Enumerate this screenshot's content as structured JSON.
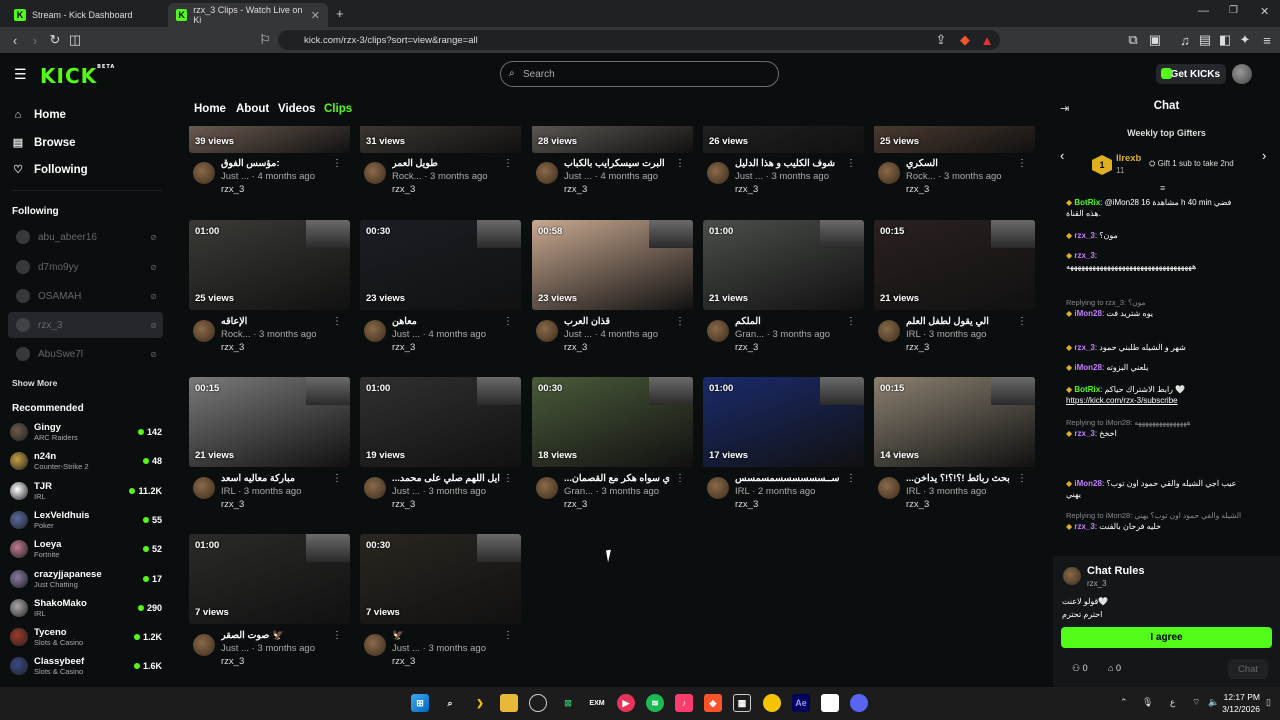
{
  "browser": {
    "tabs": [
      {
        "title": "Stream - Kick Dashboard"
      },
      {
        "title": "rzx_3 Clips - Watch Live on Ki"
      }
    ],
    "url": "kick.com/rzx-3/clips?sort=view&range=all"
  },
  "header": {
    "logo": "KICK",
    "logo_badge": "BETA",
    "search_placeholder": "Search",
    "get_kicks": "Get KICKs"
  },
  "sidebar": {
    "nav": [
      {
        "label": "Home",
        "icon": "home-icon"
      },
      {
        "label": "Browse",
        "icon": "browse-icon"
      },
      {
        "label": "Following",
        "icon": "heart-icon"
      }
    ],
    "following_title": "Following",
    "following": [
      {
        "name": "abu_abeer16"
      },
      {
        "name": "d7mo9yy"
      },
      {
        "name": "OSAMAH"
      },
      {
        "name": "rzx_3"
      },
      {
        "name": "AbuSwe7l"
      }
    ],
    "show_more": "Show More",
    "recommended_title": "Recommended",
    "recommended": [
      {
        "name": "Gingy",
        "category": "ARC Raiders",
        "viewers": "142",
        "color": "#6a5a4a"
      },
      {
        "name": "n24n",
        "category": "Counter-Strike 2",
        "viewers": "48",
        "color": "#c8a040"
      },
      {
        "name": "TJR",
        "category": "IRL",
        "viewers": "11.2K",
        "color": "#ffffff"
      },
      {
        "name": "LexVeldhuis",
        "category": "Poker",
        "viewers": "55",
        "color": "#5a6aa0"
      },
      {
        "name": "Loeya",
        "category": "Fortnite",
        "viewers": "52",
        "color": "#c07a90"
      },
      {
        "name": "crazyjjapanese",
        "category": "Just Chatting",
        "viewers": "17",
        "color": "#8a7aa0"
      },
      {
        "name": "ShakoMako",
        "category": "IRL",
        "viewers": "290",
        "color": "#aaaaaa"
      },
      {
        "name": "Tyceno",
        "category": "Slots & Casino",
        "viewers": "1.2K",
        "color": "#a03a2a"
      },
      {
        "name": "Classybeef",
        "category": "Slots & Casino",
        "viewers": "1.6K",
        "color": "#3a4a8a"
      }
    ]
  },
  "channel_tabs": [
    "Home",
    "About",
    "Videos",
    "Clips"
  ],
  "clips": [
    {
      "duration": "",
      "views": "39 views",
      "title": "مؤسس الفوق:",
      "category": "Just ...",
      "age": "4 months ago",
      "user": "rzx_3",
      "bg": "#6a5a50"
    },
    {
      "duration": "",
      "views": "31 views",
      "title": "طويل العمر",
      "category": "Rock...",
      "age": "3 months ago",
      "user": "rzx_3",
      "bg": "#3a3530"
    },
    {
      "duration": "",
      "views": "28 views",
      "title": "البرت سيسكرايب بالكباب",
      "category": "Just ...",
      "age": "4 months ago",
      "user": "rzx_3",
      "bg": "#5a5550"
    },
    {
      "duration": "",
      "views": "26 views",
      "title": "شوف الكليب و هذا الدليل",
      "category": "Just ...",
      "age": "3 months ago",
      "user": "rzx_3",
      "bg": "#202020"
    },
    {
      "duration": "",
      "views": "25 views",
      "title": "السكري",
      "category": "Rock...",
      "age": "3 months ago",
      "user": "rzx_3",
      "bg": "#4a3a30"
    },
    {
      "duration": "01:00",
      "views": "25 views",
      "title": "الإعاقه",
      "category": "Rock...",
      "age": "3 months ago",
      "user": "rzx_3",
      "bg": "#3a3a35"
    },
    {
      "duration": "00:30",
      "views": "23 views",
      "title": "معاهن",
      "category": "Just ...",
      "age": "4 months ago",
      "user": "rzx_3",
      "bg": "#1a1e24"
    },
    {
      "duration": "00:58",
      "views": "23 views",
      "title": "قذان العرب",
      "category": "Just ...",
      "age": "4 months ago",
      "user": "rzx_3",
      "bg": "#c8a890"
    },
    {
      "duration": "01:00",
      "views": "21 views",
      "title": "الملكم",
      "category": "Gran...",
      "age": "3 months ago",
      "user": "rzx_3",
      "bg": "#4a4e4a"
    },
    {
      "duration": "00:15",
      "views": "21 views",
      "title": "الي يقول لطفل العلم",
      "category": "IRL",
      "age": "3 months ago",
      "user": "rzx_3",
      "bg": "#2a2020"
    },
    {
      "duration": "00:15",
      "views": "21 views",
      "title": "مباركة معاليه اسعد",
      "category": "IRL",
      "age": "3 months ago",
      "user": "rzx_3",
      "bg": "#7a7a7a"
    },
    {
      "duration": "01:00",
      "views": "19 views",
      "title": "...ايل اللهم صلي على محمد",
      "category": "Just ...",
      "age": "3 months ago",
      "user": "rzx_3",
      "bg": "#303030"
    },
    {
      "duration": "00:30",
      "views": "18 views",
      "title": "...ي سواه هكر مع القصمان",
      "category": "Gran...",
      "age": "3 months ago",
      "user": "rzx_3",
      "bg": "#4a5a3a"
    },
    {
      "duration": "01:00",
      "views": "17 views",
      "title": "ســسسسسسسمسمسس",
      "category": "IRL",
      "age": "2 months ago",
      "user": "rzx_3",
      "bg": "#1a2a6a"
    },
    {
      "duration": "00:15",
      "views": "14 views",
      "title": "...بحث ربائط !؟!؟!؟ يداخن",
      "category": "IRL",
      "age": "3 months ago",
      "user": "rzx_3",
      "bg": "#8a8070"
    },
    {
      "duration": "01:00",
      "views": "7 views",
      "title": "صوت الصقر 🦅",
      "category": "Just ...",
      "age": "3 months ago",
      "user": "rzx_3",
      "bg": "#2a2a28"
    },
    {
      "duration": "00:30",
      "views": "7 views",
      "title": "🦅",
      "category": "Just ...",
      "age": "3 months ago",
      "user": "rzx_3",
      "bg": "#2a2520"
    }
  ],
  "chat": {
    "title": "Chat",
    "gifters_title": "Weekly top Gifters",
    "top_gifter": "llrexb",
    "top_gifter_count": "11",
    "gift_hint": "Gift 1 sub to take 2nd",
    "messages": [
      {
        "reply": "",
        "user": "BotRix",
        "color": "#53fc18",
        "text": ": @iMon28 مشاهدة 16 h 40 min فضي",
        "extra": "هذه القناة."
      },
      {
        "reply": "",
        "user": "rzx_3",
        "color": "#c77dff",
        "text": ": مون؟",
        "extra": ""
      },
      {
        "reply": "",
        "user": "rzx_3",
        "color": "#c77dff",
        "text": ":",
        "extra": "ههههههههههههههههههههههههههههههههههه"
      },
      {
        "reply": "Replying to rzx_3: مون؟",
        "user": "iMon28",
        "color": "#c77dff",
        "text": ": يوه شتريد فت",
        "extra": ""
      },
      {
        "reply": "",
        "user": "rzx_3",
        "color": "#c77dff",
        "text": ": شهر و الشيله طلبني حمود",
        "extra": ""
      },
      {
        "reply": "",
        "user": "iMon28",
        "color": "#c77dff",
        "text": ": يلعني البزوته",
        "extra": ""
      },
      {
        "reply": "",
        "user": "BotRix",
        "color": "#53fc18",
        "text": ": رابط الاشتراك حياكم 🤍",
        "extra": "https://kick.com/rzx-3/subscribe"
      },
      {
        "reply": "Replying to iMon28: هههههههههههههههه",
        "user": "rzx_3",
        "color": "#c77dff",
        "text": ": اخخخ",
        "extra": ""
      },
      {
        "reply": "",
        "user": "iMon28",
        "color": "#c77dff",
        "text": ": عيب اجي الشيله والقي حمود اون توب؟",
        "extra": "يهني"
      },
      {
        "reply": "Replying to iMon28: الشيله والقي حمود اون توب؟ يهني",
        "user": "rzx_3",
        "color": "#c77dff",
        "text": ": خليه فرحان بالفنت",
        "extra": ""
      }
    ],
    "rules_title": "Chat Rules",
    "rules_user": "rzx_3",
    "rules_lines": [
      "قولو لاعنت🤍",
      "احترم تحترم"
    ],
    "agree": "I agree",
    "counts": [
      "0",
      "0"
    ],
    "chat_button": "Chat"
  },
  "taskbar": {
    "clock_time": "12:17 PM",
    "clock_date": "3/12/2026"
  }
}
